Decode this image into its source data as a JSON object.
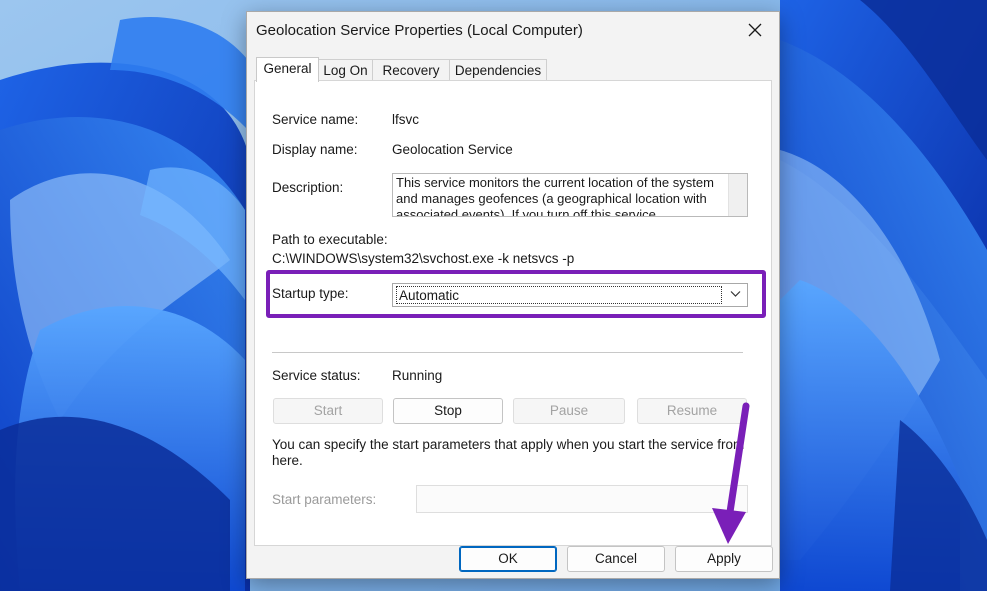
{
  "window": {
    "title": "Geolocation Service Properties (Local Computer)"
  },
  "tabs": [
    {
      "label": "General",
      "active": true
    },
    {
      "label": "Log On",
      "active": false
    },
    {
      "label": "Recovery",
      "active": false
    },
    {
      "label": "Dependencies",
      "active": false
    }
  ],
  "general": {
    "service_name_label": "Service name:",
    "service_name_value": "lfsvc",
    "display_name_label": "Display name:",
    "display_name_value": "Geolocation Service",
    "description_label": "Description:",
    "description_value": "This service monitors the current location of the system and manages geofences (a geographical location with associated events). If you turn off this service,",
    "path_label": "Path to executable:",
    "path_value": "C:\\WINDOWS\\system32\\svchost.exe -k netsvcs -p",
    "startup_type_label": "Startup type:",
    "startup_type_value": "Automatic",
    "service_status_label": "Service status:",
    "service_status_value": "Running",
    "start_button": "Start",
    "stop_button": "Stop",
    "pause_button": "Pause",
    "resume_button": "Resume",
    "start_params_note": "You can specify the start parameters that apply when you start the service from here.",
    "start_params_label": "Start parameters:",
    "start_params_value": ""
  },
  "footer": {
    "ok_button": "OK",
    "cancel_button": "Cancel",
    "apply_button": "Apply"
  },
  "colors": {
    "highlight": "#7a1fb8",
    "accent": "#0067c0"
  },
  "icons": {
    "close": "close-icon",
    "dropdown": "chevron-down-icon"
  }
}
